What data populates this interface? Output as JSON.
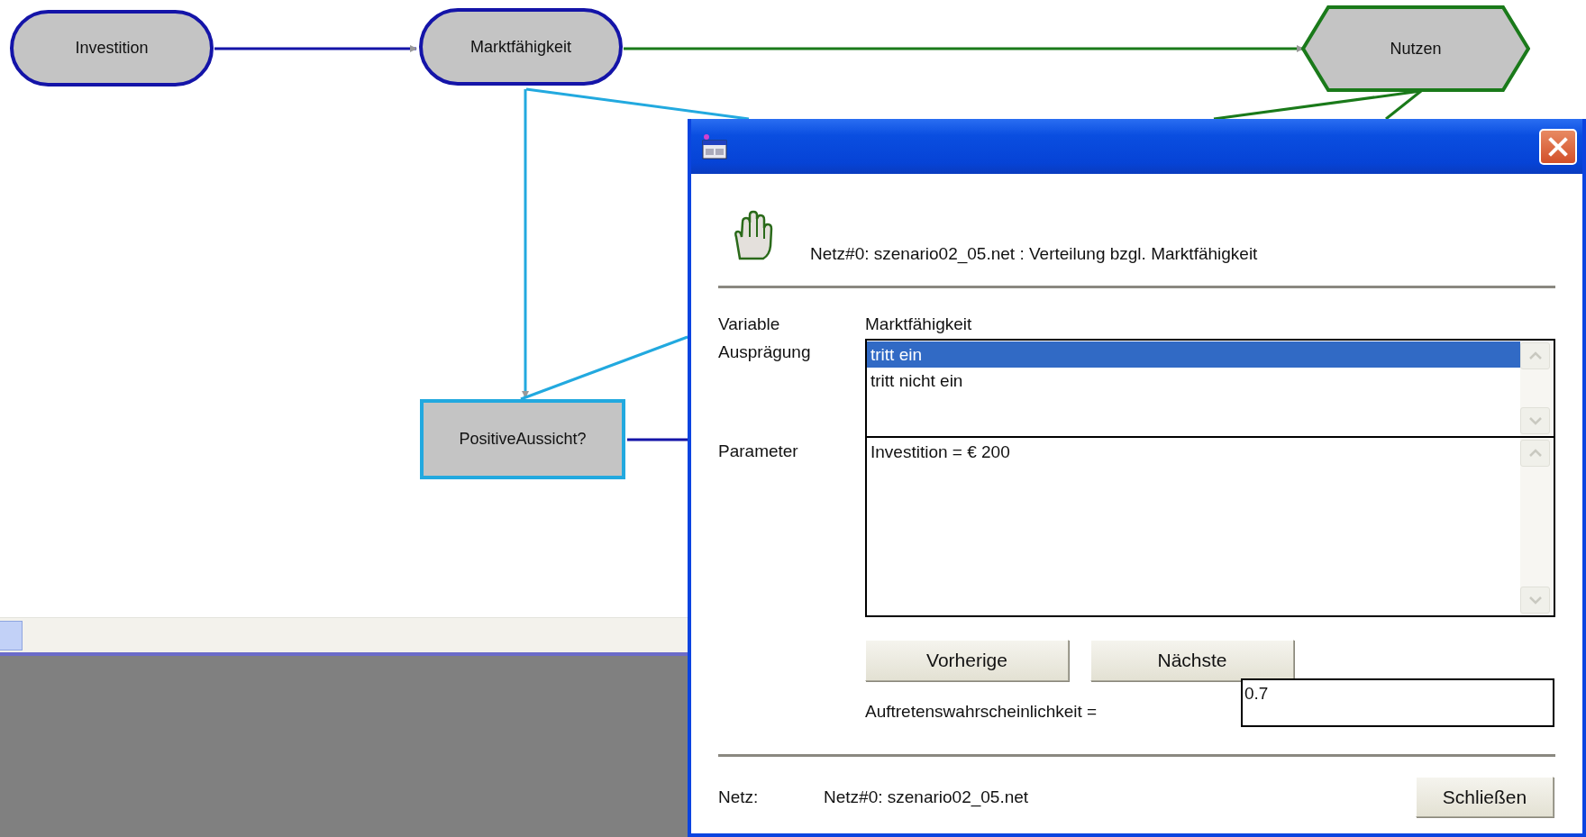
{
  "diagram": {
    "nodes": [
      {
        "label": "Investition",
        "kind": "chance"
      },
      {
        "label": "Marktfähigkeit",
        "kind": "chance"
      },
      {
        "label": "Nutzen",
        "kind": "utility"
      },
      {
        "label": "PositiveAussicht?",
        "kind": "decision"
      }
    ]
  },
  "dialog": {
    "header": "Netz#0: szenario02_05.net : Verteilung bzgl. Marktfähigkeit",
    "variable_label": "Variable",
    "variable_value": "Marktfähigkeit",
    "states_label": "Ausprägung",
    "states": [
      {
        "label": "tritt ein",
        "selected": true
      },
      {
        "label": "tritt nicht ein",
        "selected": false
      }
    ],
    "parameter_label": "Parameter",
    "parameters": [
      "Investition = € 200"
    ],
    "buttons": [
      "Vorherige",
      "Nächste"
    ],
    "probability_label": "Auftretenswahrscheinlichkeit =",
    "probability_value": "0.7",
    "net_label": "Netz:",
    "net_value": "Netz#0: szenario02_05.net",
    "close_button": "Schließen"
  }
}
